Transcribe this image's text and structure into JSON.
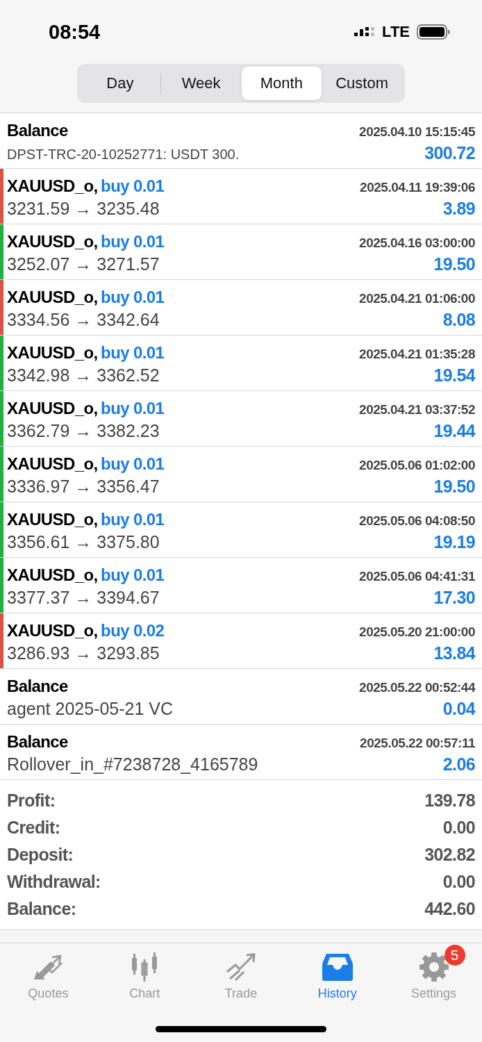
{
  "status_bar": {
    "time": "08:54",
    "network": "LTE"
  },
  "period_tabs": [
    {
      "label": "Day",
      "selected": false
    },
    {
      "label": "Week",
      "selected": false
    },
    {
      "label": "Month",
      "selected": true
    },
    {
      "label": "Custom",
      "selected": false
    }
  ],
  "history": [
    {
      "kind": "balance",
      "title": "Balance",
      "time": "2025.04.10 15:15:45",
      "comment": "DPST-TRC-20-10252771: USDT 300.",
      "amount": "300.72"
    },
    {
      "kind": "trade",
      "symbol": "XAUUSD_o,",
      "order": "buy 0.01",
      "time": "2025.04.11 19:39:06",
      "prices": "3231.59 → 3235.48",
      "amount": "3.89",
      "color": "#d9534a"
    },
    {
      "kind": "trade",
      "symbol": "XAUUSD_o,",
      "order": "buy 0.01",
      "time": "2025.04.16 03:00:00",
      "prices": "3252.07 → 3271.57",
      "amount": "19.50",
      "color": "#1fb040"
    },
    {
      "kind": "trade",
      "symbol": "XAUUSD_o,",
      "order": "buy 0.01",
      "time": "2025.04.21 01:06:00",
      "prices": "3334.56 → 3342.64",
      "amount": "8.08",
      "color": "#d9534a"
    },
    {
      "kind": "trade",
      "symbol": "XAUUSD_o,",
      "order": "buy 0.01",
      "time": "2025.04.21 01:35:28",
      "prices": "3342.98 → 3362.52",
      "amount": "19.54",
      "color": "#1fb040"
    },
    {
      "kind": "trade",
      "symbol": "XAUUSD_o,",
      "order": "buy 0.01",
      "time": "2025.04.21 03:37:52",
      "prices": "3362.79 → 3382.23",
      "amount": "19.44",
      "color": "#1fb040"
    },
    {
      "kind": "trade",
      "symbol": "XAUUSD_o,",
      "order": "buy 0.01",
      "time": "2025.05.06 01:02:00",
      "prices": "3336.97 → 3356.47",
      "amount": "19.50",
      "color": "#1fb040"
    },
    {
      "kind": "trade",
      "symbol": "XAUUSD_o,",
      "order": "buy 0.01",
      "time": "2025.05.06 04:08:50",
      "prices": "3356.61 → 3375.80",
      "amount": "19.19",
      "color": "#1fb040"
    },
    {
      "kind": "trade",
      "symbol": "XAUUSD_o,",
      "order": "buy 0.01",
      "time": "2025.05.06 04:41:31",
      "prices": "3377.37 → 3394.67",
      "amount": "17.30",
      "color": "#1fb040"
    },
    {
      "kind": "trade",
      "symbol": "XAUUSD_o,",
      "order": "buy 0.02",
      "time": "2025.05.20 21:00:00",
      "prices": "3286.93 → 3293.85",
      "amount": "13.84",
      "color": "#d9534a"
    },
    {
      "kind": "balance",
      "title": "Balance",
      "time": "2025.05.22 00:52:44",
      "comment": "agent 2025-05-21 VC",
      "amount": "0.04"
    },
    {
      "kind": "balance",
      "title": "Balance",
      "time": "2025.05.22 00:57:11",
      "comment": "Rollover_in_#7238728_4165789",
      "amount": "2.06"
    }
  ],
  "summary": [
    {
      "label": "Profit:",
      "value": "139.78"
    },
    {
      "label": "Credit:",
      "value": "0.00"
    },
    {
      "label": "Deposit:",
      "value": "302.82"
    },
    {
      "label": "Withdrawal:",
      "value": "0.00"
    },
    {
      "label": "Balance:",
      "value": "442.60"
    }
  ],
  "tab_bar": [
    {
      "label": "Quotes",
      "selected": false
    },
    {
      "label": "Chart",
      "selected": false
    },
    {
      "label": "Trade",
      "selected": false
    },
    {
      "label": "History",
      "selected": true
    },
    {
      "label": "Settings",
      "selected": false,
      "badge": "5"
    }
  ]
}
